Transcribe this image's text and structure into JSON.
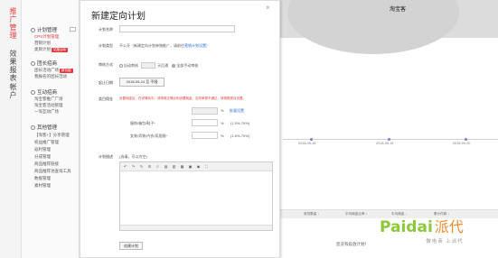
{
  "left_nav": {
    "tab1": "推广管理",
    "tab2": "效果报表",
    "tab3": "帐户"
  },
  "submenu": {
    "sec1": "计划管理",
    "sec1_items": [
      "CPS计划管理",
      "营销计划",
      "类目计划"
    ],
    "sec1_badge": "站推活动",
    "sec2": "团长招商",
    "sec2_items": [
      "团长活动广场",
      "我报名的团长活动"
    ],
    "sec2_badge": "新功能",
    "sec3": "互动招商",
    "sec3_items": [
      "淘宝客推广广场",
      "淘宝客活动管理",
      "一淘互动广场"
    ],
    "sec4": "其他管理",
    "sec4_items": [
      "【淘客+】分享管理",
      "权益推广管理",
      "返利管理",
      "分成管理",
      "商品推荐链接",
      "商品推荐池查询工具",
      "数据管理",
      "素材管理"
    ]
  },
  "modal": {
    "title": "新建定向计划",
    "close": "×",
    "plan_name_label": "计划名称",
    "plan_type_label": "计划类型",
    "plan_type_text": "不公开（新建定向计划单独推广，请前往",
    "plan_type_link": "营销计划设置",
    "plan_type_text_end": "）",
    "review_label": "审核方式",
    "review_opt1": "自动审核",
    "review_days": "",
    "review_opt1_suffix": "天后通",
    "review_opt2": "全部手动审核",
    "start_date_label": "起止日期",
    "start_date_value": "2018-09-24 至 不限",
    "commission_label": "类目佣金",
    "commission_notice": "设置佣金后，在详情页中，请按照正确比例设置佣金，否则审核不通过，请按照类目设置。",
    "commission_pct": "%",
    "commission_link": "批量设置",
    "item1_label": "服饰/箱包/鞋子*",
    "item1_range": "(1.5%-70%)",
    "item2_label": "女装/男装/内衣/家居服*",
    "item2_range": "(1.5%-70%)",
    "desc_label": "计划描述",
    "desc_hint": "(选填，可以为空)",
    "create_button": "创建计划"
  },
  "background": {
    "shop_name": "淘宝客",
    "x_labels": [
      "2018-09-18",
      "2018-09-19",
      "2018-09-20"
    ],
    "stats": [
      "收货数量 ↓",
      "平均佣金比率 ↓",
      "平均佣金 ↓",
      "累计付款 ↓"
    ],
    "empty_text": "您没有投放计划！"
  },
  "watermark": {
    "brand_en": "Paidai",
    "brand_cn": "派代",
    "slogan": "做电商 上派代"
  }
}
